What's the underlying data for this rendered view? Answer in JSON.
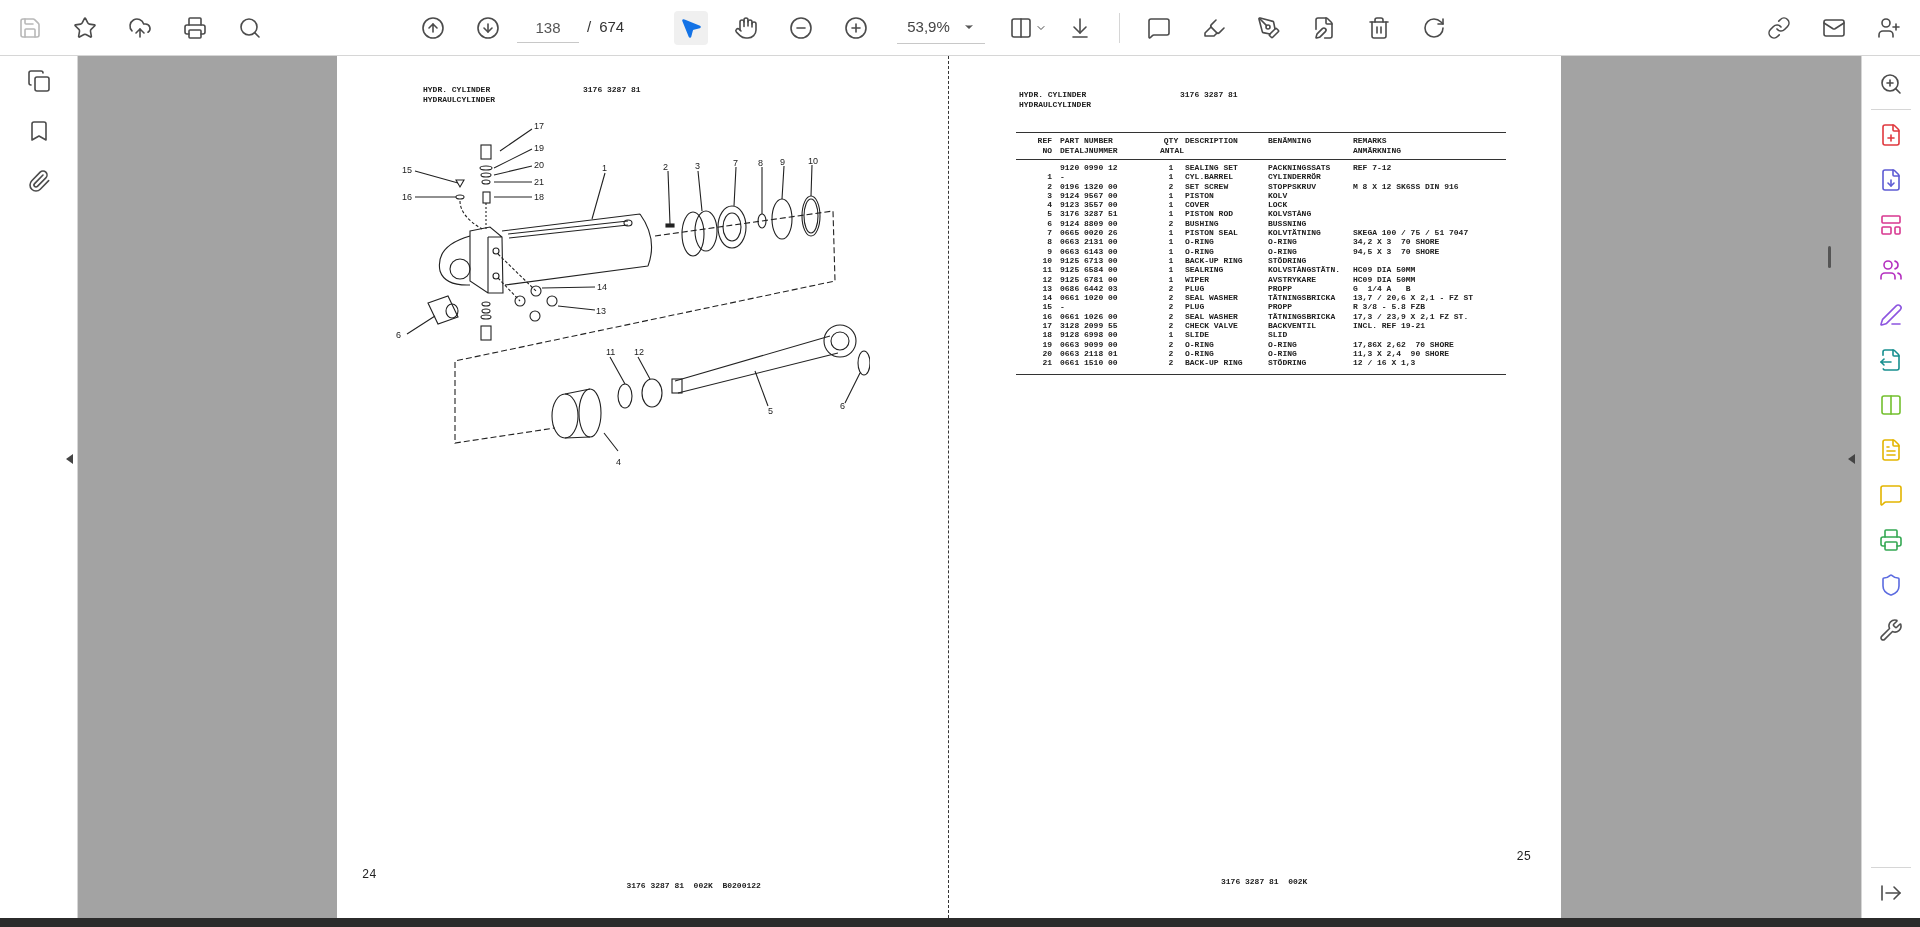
{
  "toolbar": {
    "save": {
      "disabled": true
    },
    "page_input": {
      "value": "138"
    },
    "page_separator": "/",
    "page_total": "674",
    "tools": [
      {
        "kind": "select",
        "selected": true
      },
      {
        "kind": "hand",
        "selected": false
      }
    ],
    "zoom": {
      "value": "53,9%"
    }
  },
  "left_page": {
    "title_lines": [
      "HYDR. CYLINDER",
      "HYDRAULCYLINDER"
    ],
    "part_number": "3176 3287 81",
    "callouts": [
      "17",
      "19",
      "20",
      "21",
      "15",
      "16",
      "18",
      "1",
      "2",
      "3",
      "7",
      "8",
      "9",
      "10",
      "14",
      "13",
      "6",
      "11",
      "12",
      "5",
      "6",
      "4"
    ],
    "page_number": "24",
    "footer_code": "3176 3287 81  002K  B0200122"
  },
  "right_page": {
    "title_lines": [
      "HYDR. CYLINDER",
      "HYDRAULCYLINDER"
    ],
    "part_number": "3176 3287 81",
    "table": {
      "columns": [
        {
          "lines": [
            "REF",
            "NO"
          ]
        },
        {
          "lines": [
            "PART NUMBER",
            "DETALJNUMMER"
          ]
        },
        {
          "lines": [
            "QTY",
            "ANTAL"
          ]
        },
        {
          "lines": [
            "DESCRIPTION"
          ]
        },
        {
          "lines": [
            "BENÄMNING"
          ]
        },
        {
          "lines": [
            "REMARKS",
            "ANMÄRKNING"
          ]
        }
      ],
      "rows": [
        {
          "part": "9120 0990 12",
          "qty": "1",
          "description": "SEALING SET",
          "benamning": "PACKNINGSSATS",
          "remarks": "REF 7-12"
        },
        {
          "ref": "1",
          "part": "-",
          "qty": "1",
          "description": "CYL.BARREL",
          "benamning": "CYLINDERRÖR"
        },
        {
          "ref": "2",
          "part": "0196 1320 00",
          "qty": "2",
          "description": "SET SCREW",
          "benamning": "STOPPSKRUV",
          "remarks": "M 8 X 12 SK6SS DIN 916"
        },
        {
          "ref": "3",
          "part": "9124 9567 00",
          "qty": "1",
          "description": "PISTON",
          "benamning": "KOLV"
        },
        {
          "ref": "4",
          "part": "9123 3557 00",
          "qty": "1",
          "description": "COVER",
          "benamning": "LOCK"
        },
        {
          "ref": "5",
          "part": "3176 3287 51",
          "qty": "1",
          "description": "PISTON ROD",
          "benamning": "KOLVSTÅNG"
        },
        {
          "ref": "6",
          "part": "9124 8809 00",
          "qty": "2",
          "description": "BUSHING",
          "benamning": "BUSSNING"
        },
        {
          "ref": "7",
          "part": "0665 0020 26",
          "qty": "1",
          "description": "PISTON SEAL",
          "benamning": "KOLVTÄTNING",
          "remarks": "SKEGA 100 / 75 / 51 7047"
        },
        {
          "ref": "8",
          "part": "0663 2131 00",
          "qty": "1",
          "description": "O-RING",
          "benamning": "O-RING",
          "remarks": "34,2 X 3  70 SHORE"
        },
        {
          "ref": "9",
          "part": "0663 6143 00",
          "qty": "1",
          "description": "O-RING",
          "benamning": "O-RING",
          "remarks": "94,5 X 3  70 SHORE"
        },
        {
          "ref": "10",
          "part": "9125 6713 00",
          "qty": "1",
          "description": "BACK-UP RING",
          "benamning": "STÖDRING"
        },
        {
          "ref": "11",
          "part": "9125 6584 00",
          "qty": "1",
          "description": "SEALRING",
          "benamning": "KOLVSTÅNGSTÄTN.",
          "remarks": "HC09 DIA 50MM"
        },
        {
          "ref": "12",
          "part": "9125 6781 00",
          "qty": "1",
          "description": "WIPER",
          "benamning": "AVSTRYKARE",
          "remarks": "HC09 DIA 50MM"
        },
        {
          "ref": "13",
          "part": "0686 6442 03",
          "qty": "2",
          "description": "PLUG",
          "benamning": "PROPP",
          "remarks": "G  1/4 A   B"
        },
        {
          "ref": "14",
          "part": "0661 1020 00",
          "qty": "2",
          "description": "SEAL WASHER",
          "benamning": "TÄTNINGSBRICKA",
          "remarks": "13,7 / 20,6 X 2,1 - FZ ST"
        },
        {
          "ref": "15",
          "part": "-",
          "qty": "2",
          "description": "PLUG",
          "benamning": "PROPP",
          "remarks": "R 3/8 - 5.8 FZB"
        },
        {
          "ref": "16",
          "part": "0661 1026 00",
          "qty": "2",
          "description": "SEAL WASHER",
          "benamning": "TÄTNINGSBRICKA",
          "remarks": "17,3 / 23,9 X 2,1 FZ ST."
        },
        {
          "ref": "17",
          "part": "3128 2099 55",
          "qty": "2",
          "description": "CHECK VALVE",
          "benamning": "BACKVENTIL",
          "remarks": "INCL. REF 19-21"
        },
        {
          "ref": "18",
          "part": "9128 6998 00",
          "qty": "1",
          "description": "SLIDE",
          "benamning": "SLID"
        },
        {
          "ref": "19",
          "part": "0663 9099 00",
          "qty": "2",
          "description": "O-RING",
          "benamning": "O-RING",
          "remarks": "17,86X 2,62  70 SHORE"
        },
        {
          "ref": "20",
          "part": "0663 2118 01",
          "qty": "2",
          "description": "O-RING",
          "benamning": "O-RING",
          "remarks": "11,3 X 2,4  90 SHORE"
        },
        {
          "ref": "21",
          "part": "0661 1510 00",
          "qty": "2",
          "description": "BACK-UP RING",
          "benamning": "STÖDRING",
          "remarks": "12 / 16 X 1,3"
        }
      ]
    },
    "page_number": "25",
    "footer_code": "3176 3287 81  002K"
  }
}
